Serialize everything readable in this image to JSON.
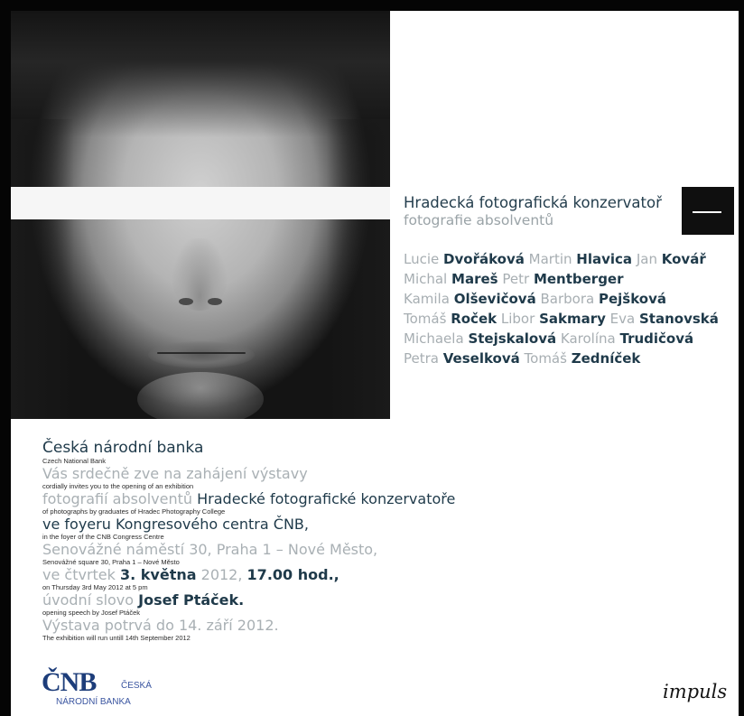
{
  "exhibition": {
    "title": "Hradecká fotografická konzervatoř",
    "subtitle": "fotografie absolventů"
  },
  "graduates": [
    [
      {
        "first": "Lucie",
        "last": "Dvořáková"
      },
      {
        "first": "Martin",
        "last": "Hlavica"
      },
      {
        "first": "Jan",
        "last": "Kovář"
      }
    ],
    [
      {
        "first": "Michal",
        "last": "Mareš"
      },
      {
        "first": "Petr",
        "last": "Mentberger"
      }
    ],
    [
      {
        "first": "Kamila",
        "last": "Olševičová"
      },
      {
        "first": "Barbora",
        "last": "Pejšková"
      }
    ],
    [
      {
        "first": "Tomáš",
        "last": "Roček"
      },
      {
        "first": "Libor",
        "last": "Sakmary"
      },
      {
        "first": "Eva",
        "last": "Stanovská"
      }
    ],
    [
      {
        "first": "Michaela",
        "last": "Stejskalová"
      },
      {
        "first": "Karolína",
        "last": "Trudičová"
      }
    ],
    [
      {
        "first": "Petra",
        "last": "Veselková"
      },
      {
        "first": "Tomáš",
        "last": "Zedníček"
      }
    ]
  ],
  "invitation": {
    "bank_cz": "Česká národní banka",
    "bank_en": "Czech National Bank",
    "invites_cz": "Vás srdečně zve na zahájení výstavy",
    "invites_en": "cordially invites you to the opening of an exhibition",
    "photos_cz_a": "fotografií absolventů",
    "photos_cz_b": "Hradecké fotografické konzervatoře",
    "photos_en": "of photographs by graduates of Hradec Photography College",
    "venue_cz": "ve foyeru Kongresového centra ČNB,",
    "venue_en": "in the foyer of the CNB Congress Centre",
    "address_cz": "Senovážné náměstí 30, Praha 1 – Nové Město,",
    "address_en": "Senovážné square 30, Praha 1 – Nové Město",
    "date_cz_a": "ve čtvrtek",
    "date_cz_b": "3. května",
    "date_cz_c": "2012,",
    "date_cz_d": "17.00 hod.,",
    "date_en": "on Thursday 3rd May 2012 at 5 pm",
    "speech_cz_a": "úvodní slovo",
    "speech_cz_b": "Josef Ptáček.",
    "speech_en": "opening speech by Josef Ptáček",
    "runs_cz": "Výstava potrvá do 14. září 2012.",
    "runs_en": "The exhibition will run untill 14th September 2012"
  },
  "logos": {
    "cnb_mark": "ČNB",
    "cnb_line1": "ČESKÁ",
    "cnb_line2": "NÁRODNÍ BANKA",
    "impuls": "impuls"
  },
  "colors": {
    "accent_dark": "#1f3a4a",
    "accent_grey": "#a9b0b4",
    "cnb_blue": "#1d3d7a"
  }
}
